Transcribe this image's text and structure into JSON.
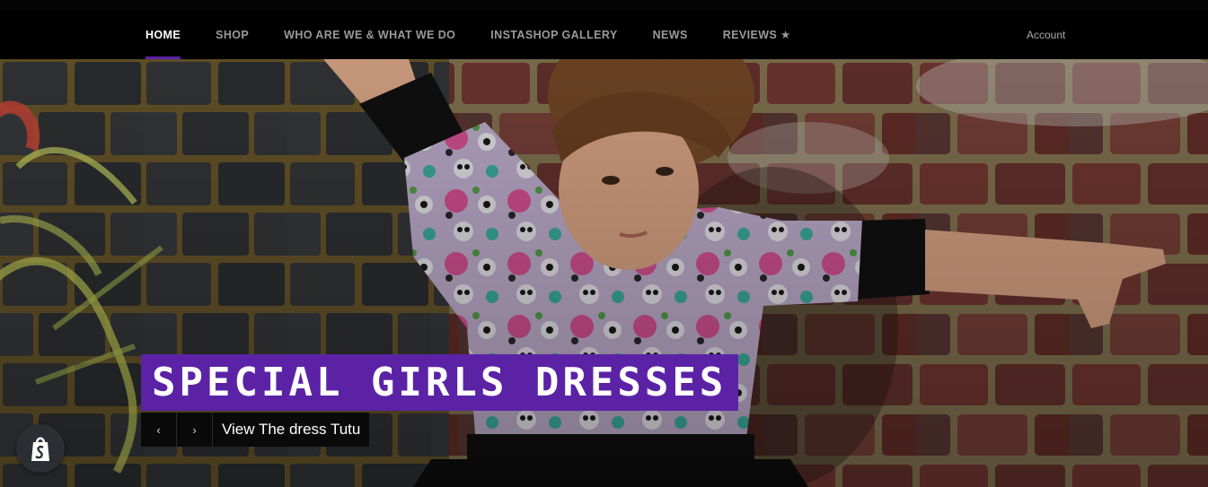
{
  "nav": {
    "items": [
      {
        "label": "HOME"
      },
      {
        "label": "SHOP"
      },
      {
        "label": "WHO ARE WE & WHAT WE DO"
      },
      {
        "label": "INSTASHOP GALLERY"
      },
      {
        "label": "NEWS"
      },
      {
        "label": "REVIEWS ★"
      }
    ],
    "active_index": 0,
    "account_label": "Account"
  },
  "hero": {
    "title": "SPECIAL GIRLS DRESSES",
    "prev_icon": "chevron-left-icon",
    "next_icon": "chevron-right-icon",
    "prev_glyph": "‹",
    "next_glyph": "›",
    "link_label": "View The dress Tutu",
    "image": "girl-in-sugar-skull-dress-against-brick-wall"
  },
  "badge": {
    "icon": "shopify-bag-icon"
  },
  "colors": {
    "accent": "#5b22a6",
    "nav_bg": "#000000",
    "nav_text": "#9a9a9a",
    "nav_active": "#ffffff"
  }
}
